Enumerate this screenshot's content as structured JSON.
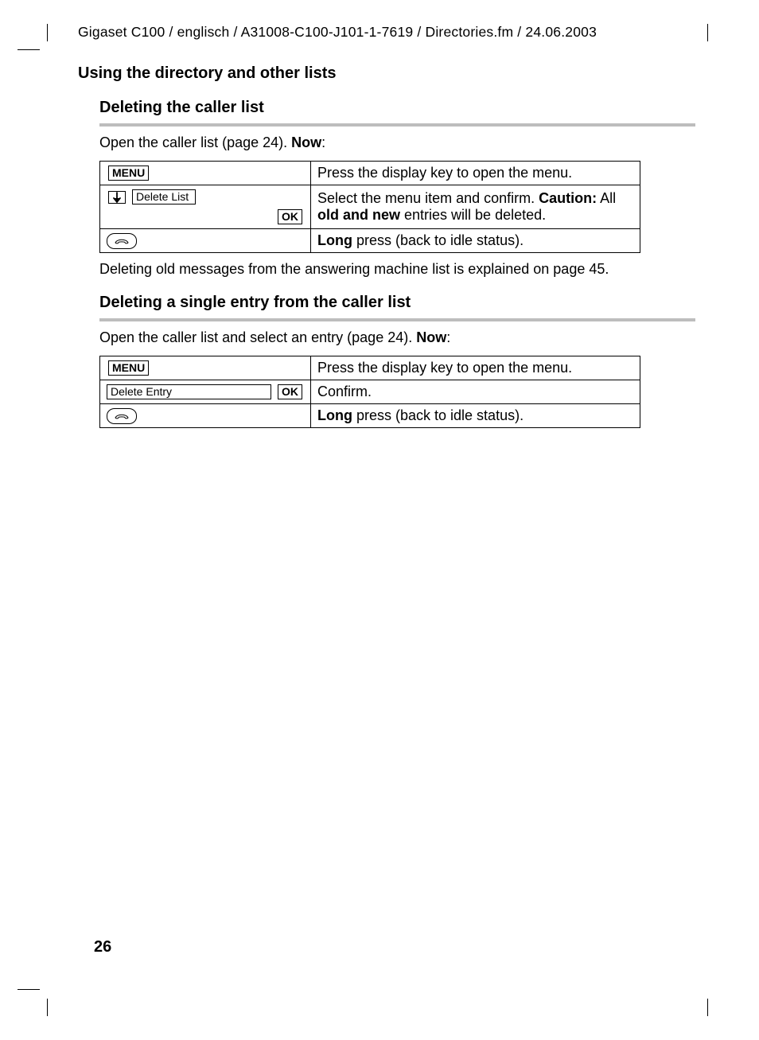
{
  "header_path": "Gigaset C100 / englisch / A31008-C100-J101-1-7619 / Directories.fm / 24.06.2003",
  "section_title": "Using the directory and other lists",
  "page_number": "26",
  "keys": {
    "menu": "MENU",
    "ok": "OK",
    "down_icon": "↓"
  },
  "sec1": {
    "heading": "Deleting the caller list",
    "intro_plain": "Open the caller list (page 24). ",
    "intro_bold": "Now",
    "intro_tail": ":",
    "rows": [
      {
        "type": "menu",
        "desc": "Press the display key to open the menu."
      },
      {
        "type": "nav_ok",
        "nav_label": "Delete List",
        "desc_pre": "Select the menu item and confirm. ",
        "desc_b1": "Caution:",
        "desc_mid": " All ",
        "desc_b2": "old and new",
        "desc_post": " entries will be deleted."
      },
      {
        "type": "hangup",
        "desc_b": "Long",
        "desc_post": " press (back to idle status)."
      }
    ],
    "after": "Deleting old messages from the answering machine list is explained on page 45."
  },
  "sec2": {
    "heading": "Deleting a single entry from the caller list",
    "intro_plain": "Open the caller list and select an entry (page 24). ",
    "intro_bold": "Now",
    "intro_tail": ":",
    "rows": [
      {
        "type": "menu",
        "desc": "Press the display key to open the menu."
      },
      {
        "type": "label_ok",
        "label": "Delete Entry",
        "desc": "Confirm."
      },
      {
        "type": "hangup",
        "desc_b": "Long",
        "desc_post": " press (back to idle status)."
      }
    ]
  }
}
